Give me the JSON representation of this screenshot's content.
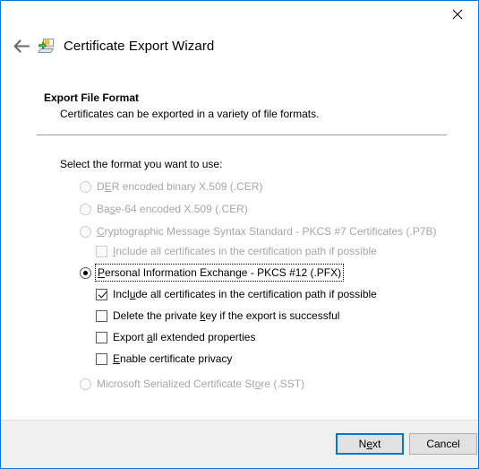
{
  "window": {
    "title": "Certificate Export Wizard",
    "close_label": "✕",
    "back_label": "←",
    "accent_color": "#0078d7",
    "icon_name": "certificate-export-icon"
  },
  "page": {
    "heading": "Export File Format",
    "subheading": "Certificates can be exported in a variety of file formats.",
    "prompt": "Select the format you want to use:"
  },
  "options": [
    {
      "id": "der",
      "type": "radio",
      "label": "DER encoded binary X.509 (.CER)",
      "accel_prefix": "D",
      "accel_char": "E",
      "accel_suffix": "R encoded binary X.509 (.CER)",
      "checked": false,
      "disabled": true,
      "focused": false,
      "indent": "radio"
    },
    {
      "id": "base64",
      "type": "radio",
      "label": "Base-64 encoded X.509 (.CER)",
      "accel_prefix": "Ba",
      "accel_char": "s",
      "accel_suffix": "e-64 encoded X.509 (.CER)",
      "checked": false,
      "disabled": true,
      "focused": false,
      "indent": "radio"
    },
    {
      "id": "pkcs7",
      "type": "radio",
      "label": "Cryptographic Message Syntax Standard - PKCS #7 Certificates (.P7B)",
      "accel_prefix": "",
      "accel_char": "C",
      "accel_suffix": "ryptographic Message Syntax Standard - PKCS #7 Certificates (.P7B)",
      "checked": false,
      "disabled": true,
      "focused": false,
      "indent": "radio"
    },
    {
      "id": "p7b-include-chain",
      "type": "checkbox",
      "label": "Include all certificates in the certification path if possible",
      "accel_prefix": "",
      "accel_char": "I",
      "accel_suffix": "nclude all certificates in the certification path if possible",
      "checked": false,
      "disabled": true,
      "focused": false,
      "indent": "check"
    },
    {
      "id": "pfx",
      "type": "radio",
      "label": "Personal Information Exchange - PKCS #12 (.PFX)",
      "accel_prefix": "",
      "accel_char": "P",
      "accel_suffix": "ersonal Information Exchange - PKCS #12 (.PFX)",
      "checked": true,
      "disabled": false,
      "focused": true,
      "indent": "radio"
    },
    {
      "id": "pfx-include-chain",
      "type": "checkbox",
      "label": "Include all certificates in the certification path if possible",
      "accel_prefix": "Incl",
      "accel_char": "u",
      "accel_suffix": "de all certificates in the certification path if possible",
      "checked": true,
      "disabled": false,
      "focused": false,
      "indent": "check"
    },
    {
      "id": "delete-private-key",
      "type": "checkbox",
      "label": "Delete the private key if the export is successful",
      "accel_prefix": "Delete the private ",
      "accel_char": "k",
      "accel_suffix": "ey if the export is successful",
      "checked": false,
      "disabled": false,
      "focused": false,
      "indent": "check"
    },
    {
      "id": "export-extended-properties",
      "type": "checkbox",
      "label": "Export all extended properties",
      "accel_prefix": "Export ",
      "accel_char": "a",
      "accel_suffix": "ll extended properties",
      "checked": false,
      "disabled": false,
      "focused": false,
      "indent": "check"
    },
    {
      "id": "enable-certificate-privacy",
      "type": "checkbox",
      "label": "Enable certificate privacy",
      "accel_prefix": "",
      "accel_char": "E",
      "accel_suffix": "nable certificate privacy",
      "checked": false,
      "disabled": false,
      "focused": false,
      "indent": "check"
    },
    {
      "id": "sst",
      "type": "radio",
      "label": "Microsoft Serialized Certificate Store (.SST)",
      "accel_prefix": "Microsoft Serialized Certificate St",
      "accel_char": "o",
      "accel_suffix": "re (.SST)",
      "checked": false,
      "disabled": true,
      "focused": false,
      "indent": "radio"
    }
  ],
  "footer": {
    "next": {
      "prefix": "N",
      "accel_char": "e",
      "suffix": "xt",
      "label": "Next",
      "default": true
    },
    "cancel": {
      "label": "Cancel",
      "default": false
    }
  }
}
